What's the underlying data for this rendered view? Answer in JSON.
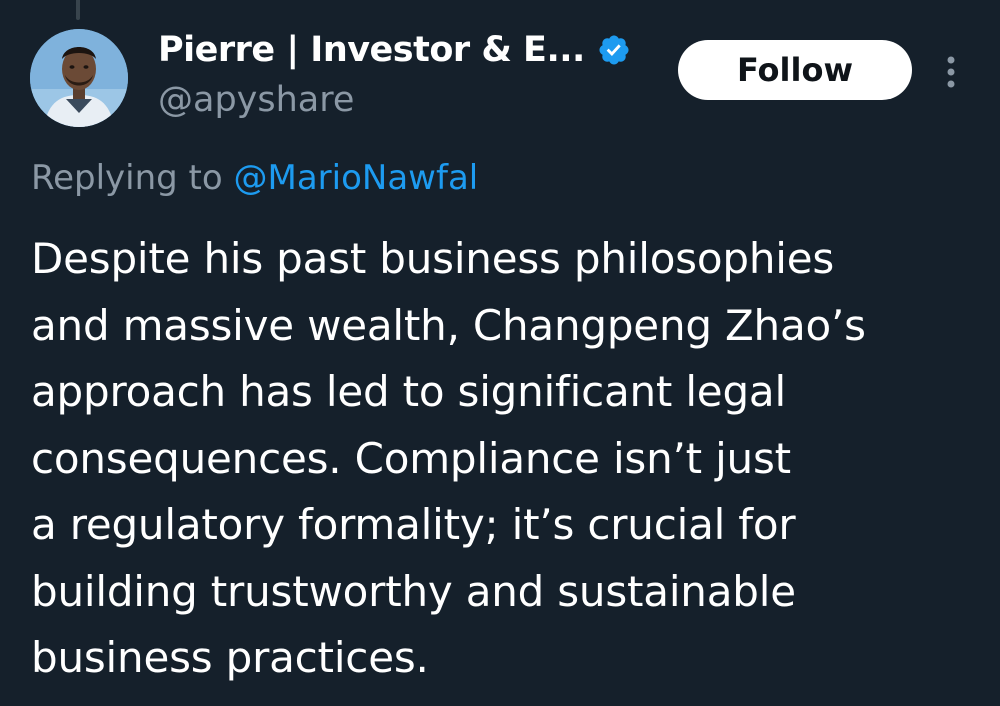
{
  "author": {
    "display_name": "Pierre | Investor & E...",
    "handle": "@apyshare",
    "verified": true,
    "avatar_icon": "avatar-photo"
  },
  "actions": {
    "follow_label": "Follow",
    "more_icon": "more-vertical-icon"
  },
  "reply": {
    "prefix": "Replying to ",
    "mention": "@MarioNawfal"
  },
  "tweet": {
    "lines": [
      "Despite his past business philosophies",
      "and massive wealth, Changpeng Zhao’s",
      "approach has led to significant legal",
      "consequences. Compliance isn’t just",
      "a regulatory formality; it’s crucial for",
      "building trustworthy and sustainable",
      "business practices."
    ]
  },
  "colors": {
    "background": "#15202b",
    "text": "#ffffff",
    "muted": "#8b98a5",
    "accent": "#1d9bf0",
    "button_bg": "#ffffff",
    "button_text": "#0f1419"
  }
}
